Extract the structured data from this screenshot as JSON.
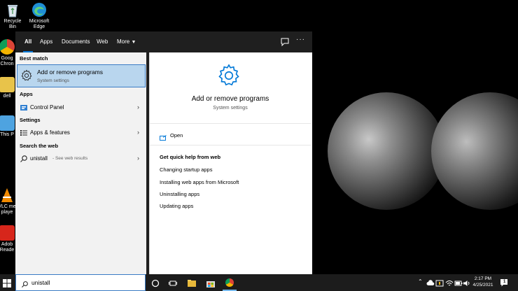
{
  "desktop": {
    "icons": [
      {
        "label": "Recycle Bin"
      },
      {
        "label": "Microsoft Edge"
      },
      {
        "label": "Goog Chron"
      },
      {
        "label": "dell"
      },
      {
        "label": "This P"
      },
      {
        "label": "VLC me playe"
      },
      {
        "label": "Adob Reade"
      }
    ]
  },
  "tabs": [
    {
      "label": "All"
    },
    {
      "label": "Apps"
    },
    {
      "label": "Documents"
    },
    {
      "label": "Web"
    },
    {
      "label": "More"
    }
  ],
  "left": {
    "best_match_heading": "Best match",
    "best_match": {
      "title": "Add or remove programs",
      "subtitle": "System settings"
    },
    "apps_heading": "Apps",
    "apps": [
      {
        "label": "Control Panel"
      }
    ],
    "settings_heading": "Settings",
    "settings": [
      {
        "label": "Apps & features"
      }
    ],
    "web_heading": "Search the web",
    "web": {
      "query": "unistall",
      "hint": "- See web results"
    }
  },
  "right": {
    "title": "Add or remove programs",
    "subtitle": "System settings",
    "open_label": "Open",
    "quick_help_heading": "Get quick help from web",
    "links": [
      {
        "label": "Changing startup apps"
      },
      {
        "label": "Installing web apps from Microsoft"
      },
      {
        "label": "Uninstalling apps"
      },
      {
        "label": "Updating apps"
      }
    ]
  },
  "taskbar": {
    "search_value": "unistall",
    "time": "2:17 PM",
    "date": "4/25/2021",
    "notification_count": "1"
  },
  "colors": {
    "accent": "#0078d7",
    "selection": "#b9d6ee"
  }
}
